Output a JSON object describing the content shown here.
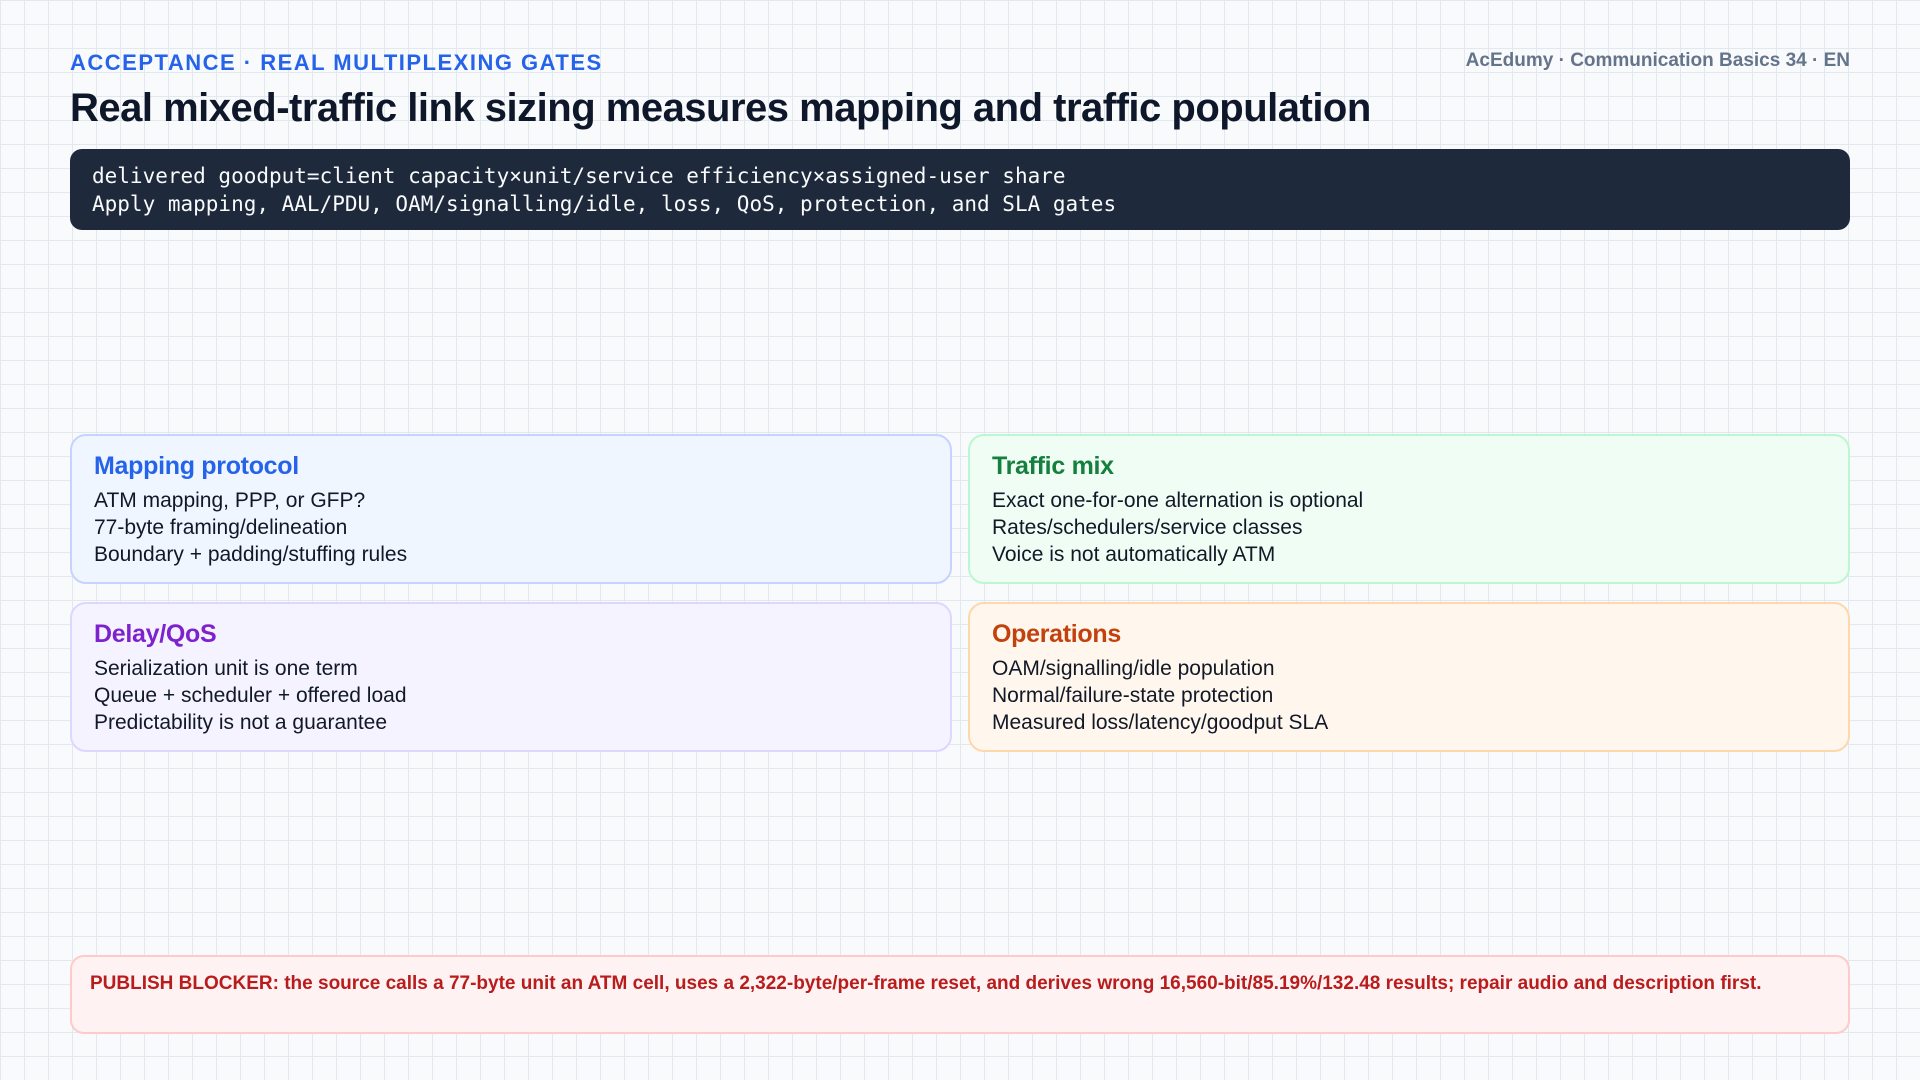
{
  "header": {
    "kicker": "ACCEPTANCE · REAL MULTIPLEXING GATES",
    "course": "AcEdumy · Communication Basics 34 · EN",
    "title": "Real mixed-traffic link sizing measures mapping and traffic population"
  },
  "formula": {
    "line1": "delivered goodput=client capacity×unit/service efficiency×assigned-user share",
    "line2": "Apply mapping, AAL/PDU, OAM/signalling/idle, loss, QoS, protection, and SLA gates"
  },
  "cards": [
    {
      "title": "Mapping protocol",
      "lines": [
        "ATM mapping, PPP, or GFP?",
        "77-byte framing/delineation",
        "Boundary + padding/stuffing rules"
      ]
    },
    {
      "title": "Traffic mix",
      "lines": [
        "Exact one-for-one alternation is optional",
        "Rates/schedulers/service classes",
        "Voice is not automatically ATM"
      ]
    },
    {
      "title": "Delay/QoS",
      "lines": [
        "Serialization unit is one term",
        "Queue + scheduler + offered load",
        "Predictability is not a guarantee"
      ]
    },
    {
      "title": "Operations",
      "lines": [
        "OAM/signalling/idle population",
        "Normal/failure-state protection",
        "Measured loss/latency/goodput SLA"
      ]
    }
  ],
  "blocker": {
    "text": "PUBLISH BLOCKER: the source calls a 77-byte unit an ATM cell, uses a 2,322-byte/per-frame reset, and derives wrong 16,560-bit/85.19%/132.48 results; repair audio and description first."
  },
  "colors": {
    "kicker": "#2563eb",
    "formula_bg": "#1e293b",
    "mapping": "#2563eb",
    "traffic": "#15803d",
    "delay": "#7e22ce",
    "operations": "#c2410c",
    "blocker": "#b91c1c"
  }
}
